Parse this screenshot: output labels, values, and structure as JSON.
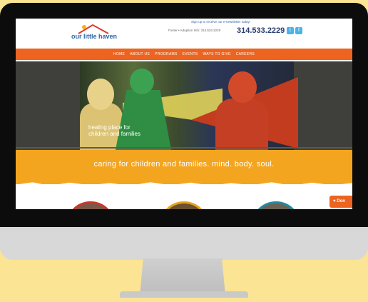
{
  "header": {
    "logo_text": "our little haven",
    "promo": "Sign up to receive our e-newsletter today!",
    "subline": "Foster • Adoption Info: 314.533.2229",
    "phone": "314.533.2229",
    "social": [
      {
        "icon": "twitter-icon",
        "glyph": "t"
      },
      {
        "icon": "facebook-icon",
        "glyph": "f"
      }
    ]
  },
  "nav": {
    "items": [
      "HOME",
      "ABOUT US",
      "PROGRAMS",
      "EVENTS",
      "WAYS TO GIVE",
      "CAREERS"
    ]
  },
  "hero": {
    "caption": "healing place for\nchildren and families"
  },
  "banner": {
    "tagline": "caring for children and families. mind. body. soul."
  },
  "donate": {
    "label": "Don",
    "icon": "heart-icon"
  },
  "colors": {
    "background": "#fbe493",
    "nav": "#ec6420",
    "banner": "#f4a51f",
    "phone": "#2a3d72"
  }
}
